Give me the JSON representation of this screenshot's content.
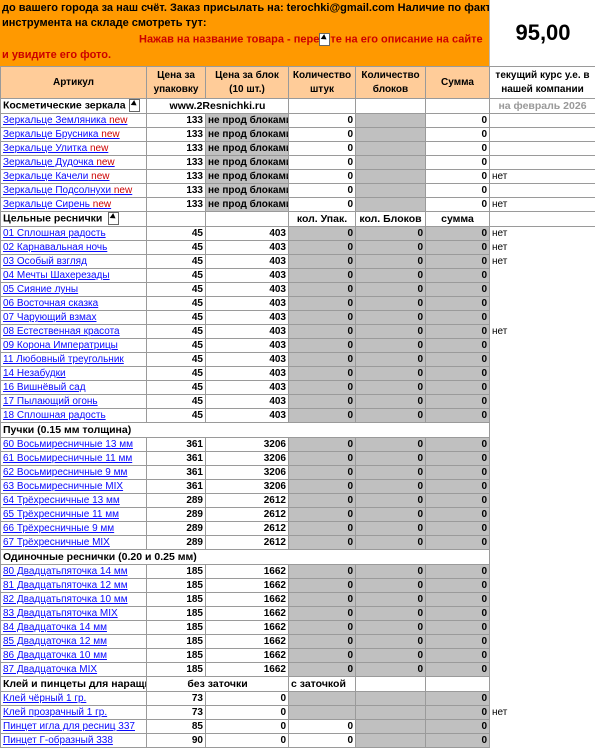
{
  "header": {
    "line1": "до вашего города за наш счёт.  Заказ присылать на: terochki@gmail.com Наличие по факту",
    "line2": "инструмента на складе смотреть тут:",
    "line3_red_before": "Нажав на название товара - пере",
    "line3_red_after": "те на его описание на сайте",
    "line4_red": "и увидите его фото.",
    "rate_value": "95,00"
  },
  "columns": {
    "article": "Артикул",
    "pack_price": "Цена за упаковку",
    "block_price": "Цена за блок (10 шт.)",
    "qty_pieces": "Количество штук",
    "qty_blocks": "Количество блоков",
    "sum": "Сумма",
    "rate_caption": "текущий курс у.е. в нашей компании"
  },
  "sections": {
    "mirrors": {
      "title": "Косметические зеркала",
      "site": "www.2Resnichki.ru",
      "date_note": "на февраль 2026"
    },
    "lashes": {
      "title": "Цельные реснички",
      "col_q1": "кол. Упак.",
      "col_q2": "кол. Блоков",
      "col_sum": "сумма"
    },
    "bundles": {
      "title": "Пучки (0.15 мм толщина)"
    },
    "singles": {
      "title": "Одиночные реснички (0.20 и 0.25 мм)"
    },
    "glue": {
      "title": "Клей и пинцеты для наращивания",
      "col_a": "без заточки",
      "col_b": "с заточкой"
    }
  },
  "mirrors": [
    {
      "name": "Зеркальце Земляника",
      "tag": "new",
      "pack": "133",
      "block": "не прод блоками",
      "q1": "0",
      "sum": "0",
      "extra": ""
    },
    {
      "name": "Зеркальце Брусника",
      "tag": "new",
      "pack": "133",
      "block": "не прод блоками",
      "q1": "0",
      "sum": "0",
      "extra": ""
    },
    {
      "name": "Зеркальце Улитка",
      "tag": "new",
      "pack": "133",
      "block": "не прод блоками",
      "q1": "0",
      "sum": "0",
      "extra": ""
    },
    {
      "name": "Зеркальце Дудочка",
      "tag": "new",
      "pack": "133",
      "block": "не прод блоками",
      "q1": "0",
      "sum": "0",
      "extra": ""
    },
    {
      "name": "Зеркальце Качели",
      "tag": "new",
      "pack": "133",
      "block": "не прод блоками",
      "q1": "0",
      "sum": "0",
      "extra": "нет"
    },
    {
      "name": "Зеркальце Подсолнухи",
      "tag": "new",
      "pack": "133",
      "block": "не прод блоками",
      "q1": "0",
      "sum": "0",
      "extra": ""
    },
    {
      "name": "Зеркальце Сирень",
      "tag": "new",
      "pack": "133",
      "block": "не прод блоками",
      "q1": "0",
      "sum": "0",
      "extra": "нет"
    }
  ],
  "lashes": [
    {
      "name": "01 Сплошная радость",
      "pack": "45",
      "block": "403",
      "q1": "0",
      "q2": "0",
      "sum": "0",
      "extra": "нет"
    },
    {
      "name": "02 Карнавальная ночь",
      "pack": "45",
      "block": "403",
      "q1": "0",
      "q2": "0",
      "sum": "0",
      "extra": "нет"
    },
    {
      "name": "03 Особый взгляд",
      "pack": "45",
      "block": "403",
      "q1": "0",
      "q2": "0",
      "sum": "0",
      "extra": "нет"
    },
    {
      "name": "04 Мечты Шахерезады",
      "pack": "45",
      "block": "403",
      "q1": "0",
      "q2": "0",
      "sum": "0",
      "extra": ""
    },
    {
      "name": "05 Сияние луны",
      "pack": "45",
      "block": "403",
      "q1": "0",
      "q2": "0",
      "sum": "0",
      "extra": ""
    },
    {
      "name": "06 Восточная сказка",
      "pack": "45",
      "block": "403",
      "q1": "0",
      "q2": "0",
      "sum": "0",
      "extra": ""
    },
    {
      "name": "07 Чарующий взмах",
      "pack": "45",
      "block": "403",
      "q1": "0",
      "q2": "0",
      "sum": "0",
      "extra": ""
    },
    {
      "name": "08 Естественная красота",
      "pack": "45",
      "block": "403",
      "q1": "0",
      "q2": "0",
      "sum": "0",
      "extra": "нет"
    },
    {
      "name": "09 Корона Императрицы",
      "pack": "45",
      "block": "403",
      "q1": "0",
      "q2": "0",
      "sum": "0",
      "extra": ""
    },
    {
      "name": "11 Любовный треугольник",
      "pack": "45",
      "block": "403",
      "q1": "0",
      "q2": "0",
      "sum": "0",
      "extra": ""
    },
    {
      "name": "14 Незабудки",
      "pack": "45",
      "block": "403",
      "q1": "0",
      "q2": "0",
      "sum": "0",
      "extra": ""
    },
    {
      "name": "16 Вишнёвый сад",
      "pack": "45",
      "block": "403",
      "q1": "0",
      "q2": "0",
      "sum": "0",
      "extra": ""
    },
    {
      "name": "17 Пылающий огонь",
      "pack": "45",
      "block": "403",
      "q1": "0",
      "q2": "0",
      "sum": "0",
      "extra": ""
    },
    {
      "name": "18 Сплошная радость",
      "pack": "45",
      "block": "403",
      "q1": "0",
      "q2": "0",
      "sum": "0",
      "extra": ""
    }
  ],
  "bundles": [
    {
      "name": "60 Восьмиресничные 13 мм",
      "pack": "361",
      "block": "3206",
      "q1": "0",
      "q2": "0",
      "sum": "0"
    },
    {
      "name": "61 Восьмиресничные 11 мм",
      "pack": "361",
      "block": "3206",
      "q1": "0",
      "q2": "0",
      "sum": "0"
    },
    {
      "name": "62 Восьмиресничные 9 мм",
      "pack": "361",
      "block": "3206",
      "q1": "0",
      "q2": "0",
      "sum": "0"
    },
    {
      "name": "63 Восьмиресничные  MIX",
      "pack": "361",
      "block": "3206",
      "q1": "0",
      "q2": "0",
      "sum": "0"
    },
    {
      "name": "64 Трёхресничные  13 мм",
      "pack": "289",
      "block": "2612",
      "q1": "0",
      "q2": "0",
      "sum": "0"
    },
    {
      "name": "65 Трёхресничные 11 мм",
      "pack": "289",
      "block": "2612",
      "q1": "0",
      "q2": "0",
      "sum": "0"
    },
    {
      "name": "66 Трёхресничные 9 мм",
      "pack": "289",
      "block": "2612",
      "q1": "0",
      "q2": "0",
      "sum": "0"
    },
    {
      "name": "67 Трёхресничные  MIX",
      "pack": "289",
      "block": "2612",
      "q1": "0",
      "q2": "0",
      "sum": "0"
    }
  ],
  "singles": [
    {
      "name": "80 Двадцатьпяточка 14 мм",
      "pack": "185",
      "block": "1662",
      "q1": "0",
      "q2": "0",
      "sum": "0"
    },
    {
      "name": "81 Двадцатьпяточка 12 мм",
      "pack": "185",
      "block": "1662",
      "q1": "0",
      "q2": "0",
      "sum": "0"
    },
    {
      "name": "82 Двадцатьпяточка 10 мм",
      "pack": "185",
      "block": "1662",
      "q1": "0",
      "q2": "0",
      "sum": "0"
    },
    {
      "name": "83 Двадцатьпяточка MIX",
      "pack": "185",
      "block": "1662",
      "q1": "0",
      "q2": "0",
      "sum": "0"
    },
    {
      "name": "84 Двадцаточка 14 мм",
      "pack": "185",
      "block": "1662",
      "q1": "0",
      "q2": "0",
      "sum": "0"
    },
    {
      "name": "85 Двадцаточка 12 мм",
      "pack": "185",
      "block": "1662",
      "q1": "0",
      "q2": "0",
      "sum": "0"
    },
    {
      "name": "86 Двадцаточка 10 мм",
      "pack": "185",
      "block": "1662",
      "q1": "0",
      "q2": "0",
      "sum": "0"
    },
    {
      "name": "87 Двадцаточка MIX",
      "pack": "185",
      "block": "1662",
      "q1": "0",
      "q2": "0",
      "sum": "0"
    }
  ],
  "glue": [
    {
      "name": "Клей чёрный 1 гр.",
      "a": "73",
      "b": "0",
      "q2": "",
      "sum": "0",
      "extra": ""
    },
    {
      "name": "Клей прозрачный 1 гр.",
      "a": "73",
      "b": "0",
      "q2": "",
      "sum": "0",
      "extra": "нет"
    },
    {
      "name": "Пинцет игла  для ресниц 337",
      "a": "85",
      "b": "0",
      "q2": "0",
      "sum": "0",
      "extra": ""
    },
    {
      "name": "Пинцет Г-образный 338",
      "a": "90",
      "b": "0",
      "q2": "0",
      "sum": "0",
      "extra": ""
    }
  ]
}
